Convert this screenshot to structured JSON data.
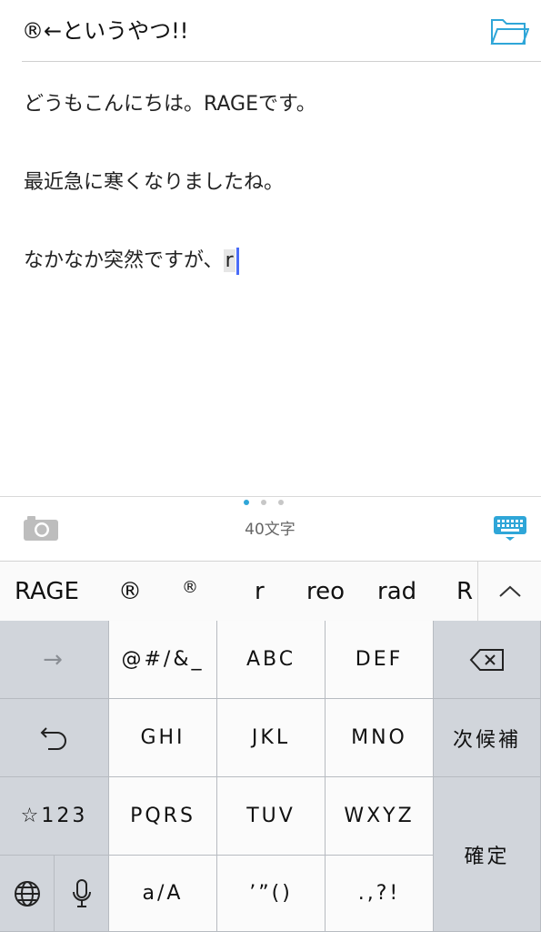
{
  "note": {
    "title": "®←というやつ!!",
    "lines": [
      "どうもこんにちは。RAGEです。",
      "最近急に寒くなりましたね。",
      "なかなか突然ですが、"
    ],
    "composing_text": "r"
  },
  "toolbar": {
    "char_count": "40文字",
    "page_dots": 3,
    "active_dot": 0,
    "accent_color": "#2fa6d8"
  },
  "candidates": [
    "RAGE",
    "®",
    "®",
    "r",
    "reo",
    "rad",
    "R"
  ],
  "keyboard": {
    "rows": [
      [
        "→",
        "@#/&_",
        "ABC",
        "DEF",
        "⌫"
      ],
      [
        "↺",
        "GHI",
        "JKL",
        "MNO",
        "次候補"
      ],
      [
        "☆123",
        "PQRS",
        "TUV",
        "WXYZ",
        "確定"
      ],
      [
        "globe",
        "mic",
        "a/A",
        "’”()",
        ".,?!"
      ]
    ]
  }
}
